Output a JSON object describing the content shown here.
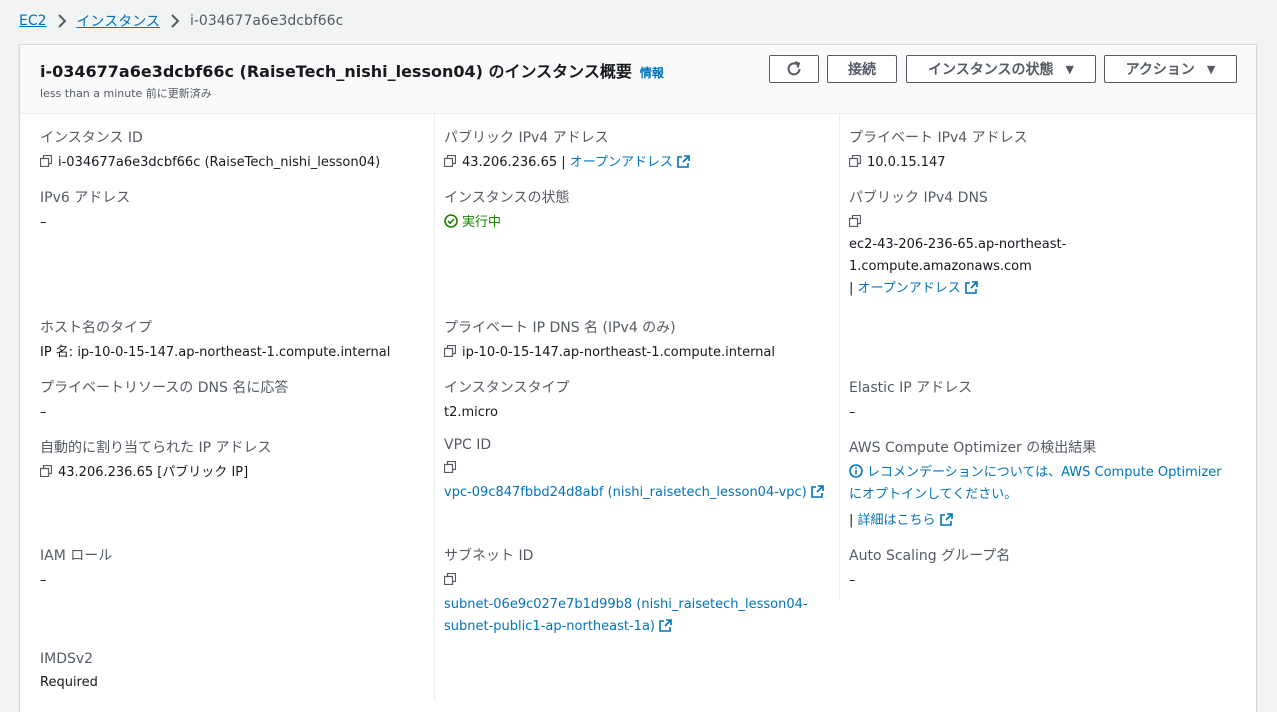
{
  "breadcrumb": {
    "items": [
      "EC2",
      "インスタンス"
    ],
    "current": "i-034677a6e3dcbf66c"
  },
  "header": {
    "title": "i-034677a6e3dcbf66c (RaiseTech_nishi_lesson04) のインスタンス概要",
    "info": "情報",
    "subtitle": "less than a minute 前に更新済み",
    "buttons": {
      "connect": "接続",
      "instance_state": "インスタンスの状態",
      "actions": "アクション"
    }
  },
  "details": {
    "instance_id": {
      "label": "インスタンス ID",
      "value": "i-034677a6e3dcbf66c (RaiseTech_nishi_lesson04)"
    },
    "public_ipv4": {
      "label": "パブリック IPv4 アドレス",
      "value": "43.206.236.65",
      "sep": " | ",
      "link": "オープンアドレス"
    },
    "private_ipv4": {
      "label": "プライベート IPv4 アドレス",
      "value": "10.0.15.147"
    },
    "ipv6": {
      "label": "IPv6 アドレス",
      "value": "–"
    },
    "instance_state": {
      "label": "インスタンスの状態",
      "value": "実行中"
    },
    "public_dns": {
      "label": "パブリック IPv4 DNS",
      "line1": "ec2-43-206-236-65.ap-northeast-",
      "line2": "1.compute.amazonaws.com",
      "sep": "| ",
      "link": "オープンアドレス"
    },
    "hostname_type": {
      "label": "ホスト名のタイプ",
      "value": "IP 名: ip-10-0-15-147.ap-northeast-1.compute.internal"
    },
    "private_dns": {
      "label": "プライベート IP DNS 名 (IPv4 のみ)",
      "value": "ip-10-0-15-147.ap-northeast-1.compute.internal"
    },
    "private_resource_dns": {
      "label": "プライベートリソースの DNS 名に応答",
      "value": "–"
    },
    "instance_type": {
      "label": "インスタンスタイプ",
      "value": "t2.micro"
    },
    "elastic_ip": {
      "label": "Elastic IP アドレス",
      "value": "–"
    },
    "auto_ip": {
      "label": "自動的に割り当てられた IP アドレス",
      "value": "43.206.236.65 [パブリック IP]"
    },
    "vpc_id": {
      "label": "VPC ID",
      "value": "vpc-09c847fbbd24d8abf (nishi_raisetech_lesson04-vpc)"
    },
    "optimizer": {
      "label": "AWS Compute Optimizer の検出結果",
      "line1": "レコメンデーションについては、AWS Compute Optimizer",
      "line2": "にオプトインしてください。",
      "sep": "| ",
      "link": "詳細はこちら"
    },
    "iam_role": {
      "label": "IAM ロール",
      "value": "–"
    },
    "subnet_id": {
      "label": "サブネット ID",
      "line1": "subnet-06e9c027e7b1d99b8 (nishi_raisetech_lesson04-",
      "line2": "subnet-public1-ap-northeast-1a)"
    },
    "asg": {
      "label": "Auto Scaling グループ名",
      "value": "–"
    },
    "imdsv2": {
      "label": "IMDSv2",
      "value": "Required"
    }
  },
  "colors": {
    "link": "#0073bb",
    "running": "#1d8102",
    "text": "#16191f",
    "label": "#545b64"
  },
  "icons": [
    "chevron-right-icon",
    "refresh-icon",
    "caret-down-icon",
    "copy-icon",
    "external-link-icon",
    "status-ok-icon",
    "info-icon"
  ]
}
